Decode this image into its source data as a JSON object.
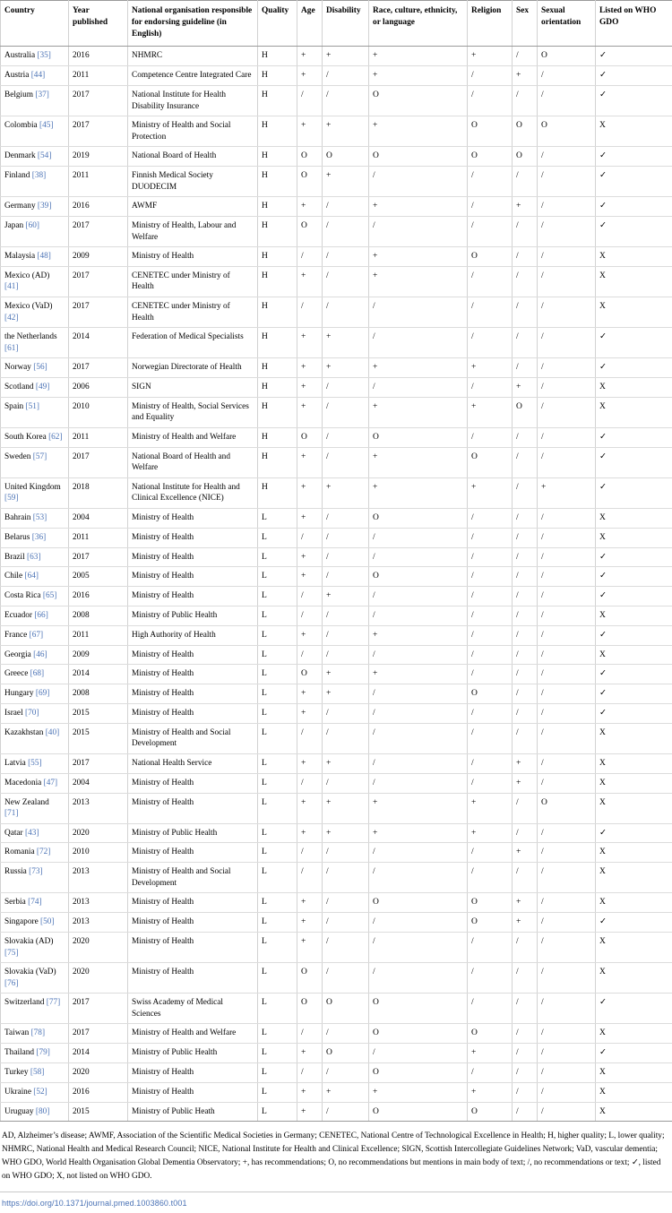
{
  "table": {
    "columns": [
      "Country",
      "Year published",
      "National organisation responsible for endorsing guideline (in English)",
      "Quality",
      "Age",
      "Disability",
      "Race, culture, ethnicity, or language",
      "Religion",
      "Sex",
      "Sexual orientation",
      "Listed on WHO GDO"
    ],
    "rows": [
      {
        "country": "Australia",
        "ref": "[35]",
        "year": "2016",
        "org": "NHMRC",
        "quality": "H",
        "age": "+",
        "disability": "+",
        "race": "+",
        "religion": "+",
        "sex": "/",
        "sexual_orientation": "O",
        "who_gdo": "✓"
      },
      {
        "country": "Austria",
        "ref": "[44]",
        "year": "2011",
        "org": "Competence Centre Integrated Care",
        "quality": "H",
        "age": "+",
        "disability": "/",
        "race": "+",
        "religion": "/",
        "sex": "+",
        "sexual_orientation": "/",
        "who_gdo": "✓"
      },
      {
        "country": "Belgium",
        "ref": "[37]",
        "year": "2017",
        "org": "National Institute for Health Disability Insurance",
        "quality": "H",
        "age": "/",
        "disability": "/",
        "race": "O",
        "religion": "/",
        "sex": "/",
        "sexual_orientation": "/",
        "who_gdo": "✓"
      },
      {
        "country": "Colombia",
        "ref": "[45]",
        "year": "2017",
        "org": "Ministry of Health and Social Protection",
        "quality": "H",
        "age": "+",
        "disability": "+",
        "race": "+",
        "religion": "O",
        "sex": "O",
        "sexual_orientation": "O",
        "who_gdo": "X"
      },
      {
        "country": "Denmark",
        "ref": "[54]",
        "year": "2019",
        "org": "National Board of Health",
        "quality": "H",
        "age": "O",
        "disability": "O",
        "race": "O",
        "religion": "O",
        "sex": "O",
        "sexual_orientation": "/",
        "who_gdo": "✓"
      },
      {
        "country": "Finland",
        "ref": "[38]",
        "year": "2011",
        "org": "Finnish Medical Society DUODECIM",
        "quality": "H",
        "age": "O",
        "disability": "+",
        "race": "/",
        "religion": "/",
        "sex": "/",
        "sexual_orientation": "/",
        "who_gdo": "✓"
      },
      {
        "country": "Germany",
        "ref": "[39]",
        "year": "2016",
        "org": "AWMF",
        "quality": "H",
        "age": "+",
        "disability": "/",
        "race": "+",
        "religion": "/",
        "sex": "+",
        "sexual_orientation": "/",
        "who_gdo": "✓"
      },
      {
        "country": "Japan",
        "ref": "[60]",
        "year": "2017",
        "org": "Ministry of Health, Labour and Welfare",
        "quality": "H",
        "age": "O",
        "disability": "/",
        "race": "/",
        "religion": "/",
        "sex": "/",
        "sexual_orientation": "/",
        "who_gdo": "✓"
      },
      {
        "country": "Malaysia",
        "ref": "[48]",
        "year": "2009",
        "org": "Ministry of Health",
        "quality": "H",
        "age": "/",
        "disability": "/",
        "race": "+",
        "religion": "O",
        "sex": "/",
        "sexual_orientation": "/",
        "who_gdo": "X"
      },
      {
        "country": "Mexico (AD)",
        "ref": "[41]",
        "year": "2017",
        "org": "CENETEC under Ministry of Health",
        "quality": "H",
        "age": "+",
        "disability": "/",
        "race": "+",
        "religion": "/",
        "sex": "/",
        "sexual_orientation": "/",
        "who_gdo": "X"
      },
      {
        "country": "Mexico (VaD)",
        "ref": "[42]",
        "year": "2017",
        "org": "CENETEC under Ministry of Health",
        "quality": "H",
        "age": "/",
        "disability": "/",
        "race": "/",
        "religion": "/",
        "sex": "/",
        "sexual_orientation": "/",
        "who_gdo": "X"
      },
      {
        "country": "the Netherlands",
        "ref": "[61]",
        "year": "2014",
        "org": "Federation of Medical Specialists",
        "quality": "H",
        "age": "+",
        "disability": "+",
        "race": "/",
        "religion": "/",
        "sex": "/",
        "sexual_orientation": "/",
        "who_gdo": "✓"
      },
      {
        "country": "Norway",
        "ref": "[56]",
        "year": "2017",
        "org": "Norwegian Directorate of Health",
        "quality": "H",
        "age": "+",
        "disability": "+",
        "race": "+",
        "religion": "+",
        "sex": "/",
        "sexual_orientation": "/",
        "who_gdo": "✓"
      },
      {
        "country": "Scotland",
        "ref": "[49]",
        "year": "2006",
        "org": "SIGN",
        "quality": "H",
        "age": "+",
        "disability": "/",
        "race": "/",
        "religion": "/",
        "sex": "+",
        "sexual_orientation": "/",
        "who_gdo": "X"
      },
      {
        "country": "Spain",
        "ref": "[51]",
        "year": "2010",
        "org": "Ministry of Health, Social Services and Equality",
        "quality": "H",
        "age": "+",
        "disability": "/",
        "race": "+",
        "religion": "+",
        "sex": "O",
        "sexual_orientation": "/",
        "who_gdo": "X"
      },
      {
        "country": "South Korea",
        "ref": "[62]",
        "year": "2011",
        "org": "Ministry of Health and Welfare",
        "quality": "H",
        "age": "O",
        "disability": "/",
        "race": "O",
        "religion": "/",
        "sex": "/",
        "sexual_orientation": "/",
        "who_gdo": "✓"
      },
      {
        "country": "Sweden",
        "ref": "[57]",
        "year": "2017",
        "org": "National Board of Health and Welfare",
        "quality": "H",
        "age": "+",
        "disability": "/",
        "race": "+",
        "religion": "O",
        "sex": "/",
        "sexual_orientation": "/",
        "who_gdo": "✓"
      },
      {
        "country": "United Kingdom",
        "ref": "[59]",
        "year": "2018",
        "org": "National Institute for Health and Clinical Excellence (NICE)",
        "quality": "H",
        "age": "+",
        "disability": "+",
        "race": "+",
        "religion": "+",
        "sex": "/",
        "sexual_orientation": "+",
        "who_gdo": "✓"
      },
      {
        "country": "Bahrain",
        "ref": "[53]",
        "year": "2004",
        "org": "Ministry of Health",
        "quality": "L",
        "age": "+",
        "disability": "/",
        "race": "O",
        "religion": "/",
        "sex": "/",
        "sexual_orientation": "/",
        "who_gdo": "X"
      },
      {
        "country": "Belarus",
        "ref": "[36]",
        "year": "2011",
        "org": "Ministry of Health",
        "quality": "L",
        "age": "/",
        "disability": "/",
        "race": "/",
        "religion": "/",
        "sex": "/",
        "sexual_orientation": "/",
        "who_gdo": "X"
      },
      {
        "country": "Brazil",
        "ref": "[63]",
        "year": "2017",
        "org": "Ministry of Health",
        "quality": "L",
        "age": "+",
        "disability": "/",
        "race": "/",
        "religion": "/",
        "sex": "/",
        "sexual_orientation": "/",
        "who_gdo": "✓"
      },
      {
        "country": "Chile",
        "ref": "[64]",
        "year": "2005",
        "org": "Ministry of Health",
        "quality": "L",
        "age": "+",
        "disability": "/",
        "race": "O",
        "religion": "/",
        "sex": "/",
        "sexual_orientation": "/",
        "who_gdo": "✓"
      },
      {
        "country": "Costa Rica",
        "ref": "[65]",
        "year": "2016",
        "org": "Ministry of Health",
        "quality": "L",
        "age": "/",
        "disability": "+",
        "race": "/",
        "religion": "/",
        "sex": "/",
        "sexual_orientation": "/",
        "who_gdo": "✓"
      },
      {
        "country": "Ecuador",
        "ref": "[66]",
        "year": "2008",
        "org": "Ministry of Public Health",
        "quality": "L",
        "age": "/",
        "disability": "/",
        "race": "/",
        "religion": "/",
        "sex": "/",
        "sexual_orientation": "/",
        "who_gdo": "X"
      },
      {
        "country": "France",
        "ref": "[67]",
        "year": "2011",
        "org": "High Authority of Health",
        "quality": "L",
        "age": "+",
        "disability": "/",
        "race": "+",
        "religion": "/",
        "sex": "/",
        "sexual_orientation": "/",
        "who_gdo": "✓"
      },
      {
        "country": "Georgia",
        "ref": "[46]",
        "year": "2009",
        "org": "Ministry of Health",
        "quality": "L",
        "age": "/",
        "disability": "/",
        "race": "/",
        "religion": "/",
        "sex": "/",
        "sexual_orientation": "/",
        "who_gdo": "X"
      },
      {
        "country": "Greece",
        "ref": "[68]",
        "year": "2014",
        "org": "Ministry of Health",
        "quality": "L",
        "age": "O",
        "disability": "+",
        "race": "+",
        "religion": "/",
        "sex": "/",
        "sexual_orientation": "/",
        "who_gdo": "✓"
      },
      {
        "country": "Hungary",
        "ref": "[69]",
        "year": "2008",
        "org": "Ministry of Health",
        "quality": "L",
        "age": "+",
        "disability": "+",
        "race": "/",
        "religion": "O",
        "sex": "/",
        "sexual_orientation": "/",
        "who_gdo": "✓"
      },
      {
        "country": "Israel",
        "ref": "[70]",
        "year": "2015",
        "org": "Ministry of Health",
        "quality": "L",
        "age": "+",
        "disability": "/",
        "race": "/",
        "religion": "/",
        "sex": "/",
        "sexual_orientation": "/",
        "who_gdo": "✓"
      },
      {
        "country": "Kazakhstan",
        "ref": "[40]",
        "year": "2015",
        "org": "Ministry of Health and Social Development",
        "quality": "L",
        "age": "/",
        "disability": "/",
        "race": "/",
        "religion": "/",
        "sex": "/",
        "sexual_orientation": "/",
        "who_gdo": "X"
      },
      {
        "country": "Latvia",
        "ref": "[55]",
        "year": "2017",
        "org": "National Health Service",
        "quality": "L",
        "age": "+",
        "disability": "+",
        "race": "/",
        "religion": "/",
        "sex": "+",
        "sexual_orientation": "/",
        "who_gdo": "X"
      },
      {
        "country": "Macedonia",
        "ref": "[47]",
        "year": "2004",
        "org": "Ministry of Health",
        "quality": "L",
        "age": "/",
        "disability": "/",
        "race": "/",
        "religion": "/",
        "sex": "+",
        "sexual_orientation": "/",
        "who_gdo": "X"
      },
      {
        "country": "New Zealand",
        "ref": "[71]",
        "year": "2013",
        "org": "Ministry of Health",
        "quality": "L",
        "age": "+",
        "disability": "+",
        "race": "+",
        "religion": "+",
        "sex": "/",
        "sexual_orientation": "O",
        "who_gdo": "X"
      },
      {
        "country": "Qatar",
        "ref": "[43]",
        "year": "2020",
        "org": "Ministry of Public Health",
        "quality": "L",
        "age": "+",
        "disability": "+",
        "race": "+",
        "religion": "+",
        "sex": "/",
        "sexual_orientation": "/",
        "who_gdo": "✓"
      },
      {
        "country": "Romania",
        "ref": "[72]",
        "year": "2010",
        "org": "Ministry of Health",
        "quality": "L",
        "age": "/",
        "disability": "/",
        "race": "/",
        "religion": "/",
        "sex": "+",
        "sexual_orientation": "/",
        "who_gdo": "X"
      },
      {
        "country": "Russia",
        "ref": "[73]",
        "year": "2013",
        "org": "Ministry of Health and Social Development",
        "quality": "L",
        "age": "/",
        "disability": "/",
        "race": "/",
        "religion": "/",
        "sex": "/",
        "sexual_orientation": "/",
        "who_gdo": "X"
      },
      {
        "country": "Serbia",
        "ref": "[74]",
        "year": "2013",
        "org": "Ministry of Health",
        "quality": "L",
        "age": "+",
        "disability": "/",
        "race": "O",
        "religion": "O",
        "sex": "+",
        "sexual_orientation": "/",
        "who_gdo": "X"
      },
      {
        "country": "Singapore",
        "ref": "[50]",
        "year": "2013",
        "org": "Ministry of Health",
        "quality": "L",
        "age": "+",
        "disability": "/",
        "race": "/",
        "religion": "O",
        "sex": "+",
        "sexual_orientation": "/",
        "who_gdo": "✓"
      },
      {
        "country": "Slovakia (AD)",
        "ref": "[75]",
        "year": "2020",
        "org": "Ministry of Health",
        "quality": "L",
        "age": "+",
        "disability": "/",
        "race": "/",
        "religion": "/",
        "sex": "/",
        "sexual_orientation": "/",
        "who_gdo": "X"
      },
      {
        "country": "Slovakia (VaD)",
        "ref": "[76]",
        "year": "2020",
        "org": "Ministry of Health",
        "quality": "L",
        "age": "O",
        "disability": "/",
        "race": "/",
        "religion": "/",
        "sex": "/",
        "sexual_orientation": "/",
        "who_gdo": "X"
      },
      {
        "country": "Switzerland",
        "ref": "[77]",
        "year": "2017",
        "org": "Swiss Academy of Medical Sciences",
        "quality": "L",
        "age": "O",
        "disability": "O",
        "race": "O",
        "religion": "/",
        "sex": "/",
        "sexual_orientation": "/",
        "who_gdo": "✓"
      },
      {
        "country": "Taiwan",
        "ref": "[78]",
        "year": "2017",
        "org": "Ministry of Health and Welfare",
        "quality": "L",
        "age": "/",
        "disability": "/",
        "race": "O",
        "religion": "O",
        "sex": "/",
        "sexual_orientation": "/",
        "who_gdo": "X"
      },
      {
        "country": "Thailand",
        "ref": "[79]",
        "year": "2014",
        "org": "Ministry of Public Health",
        "quality": "L",
        "age": "+",
        "disability": "O",
        "race": "/",
        "religion": "+",
        "sex": "/",
        "sexual_orientation": "/",
        "who_gdo": "✓"
      },
      {
        "country": "Turkey",
        "ref": "[58]",
        "year": "2020",
        "org": "Ministry of Health",
        "quality": "L",
        "age": "/",
        "disability": "/",
        "race": "O",
        "religion": "/",
        "sex": "/",
        "sexual_orientation": "/",
        "who_gdo": "X"
      },
      {
        "country": "Ukraine",
        "ref": "[52]",
        "year": "2016",
        "org": "Ministry of Health",
        "quality": "L",
        "age": "+",
        "disability": "+",
        "race": "+",
        "religion": "+",
        "sex": "/",
        "sexual_orientation": "/",
        "who_gdo": "X"
      },
      {
        "country": "Uruguay",
        "ref": "[80]",
        "year": "2015",
        "org": "Ministry of Public Heath",
        "quality": "L",
        "age": "+",
        "disability": "/",
        "race": "O",
        "religion": "O",
        "sex": "/",
        "sexual_orientation": "/",
        "who_gdo": "X"
      }
    ]
  },
  "footnote": "AD, Alzheimer’s disease; AWMF, Association of the Scientific Medical Societies in Germany; CENETEC, National Centre of Technological Excellence in Health; H, higher quality; L, lower quality; NHMRC, National Health and Medical Research Council; NICE, National Institute for Health and Clinical Excellence; SIGN, Scottish Intercollegiate Guidelines Network; VaD, vascular dementia; WHO GDO, World Health Organisation Global Dementia Observatory; +, has recommendations; O, no recommendations but mentions in main body of text; /, no recommendations or text; ✓, listed on WHO GDO; X, not listed on WHO GDO.",
  "doi": "https://doi.org/10.1371/journal.pmed.1003860.t001",
  "colors": {
    "link": "#4a72b5",
    "border": "#c9c9c9",
    "header_rule": "#9a9a9a"
  }
}
